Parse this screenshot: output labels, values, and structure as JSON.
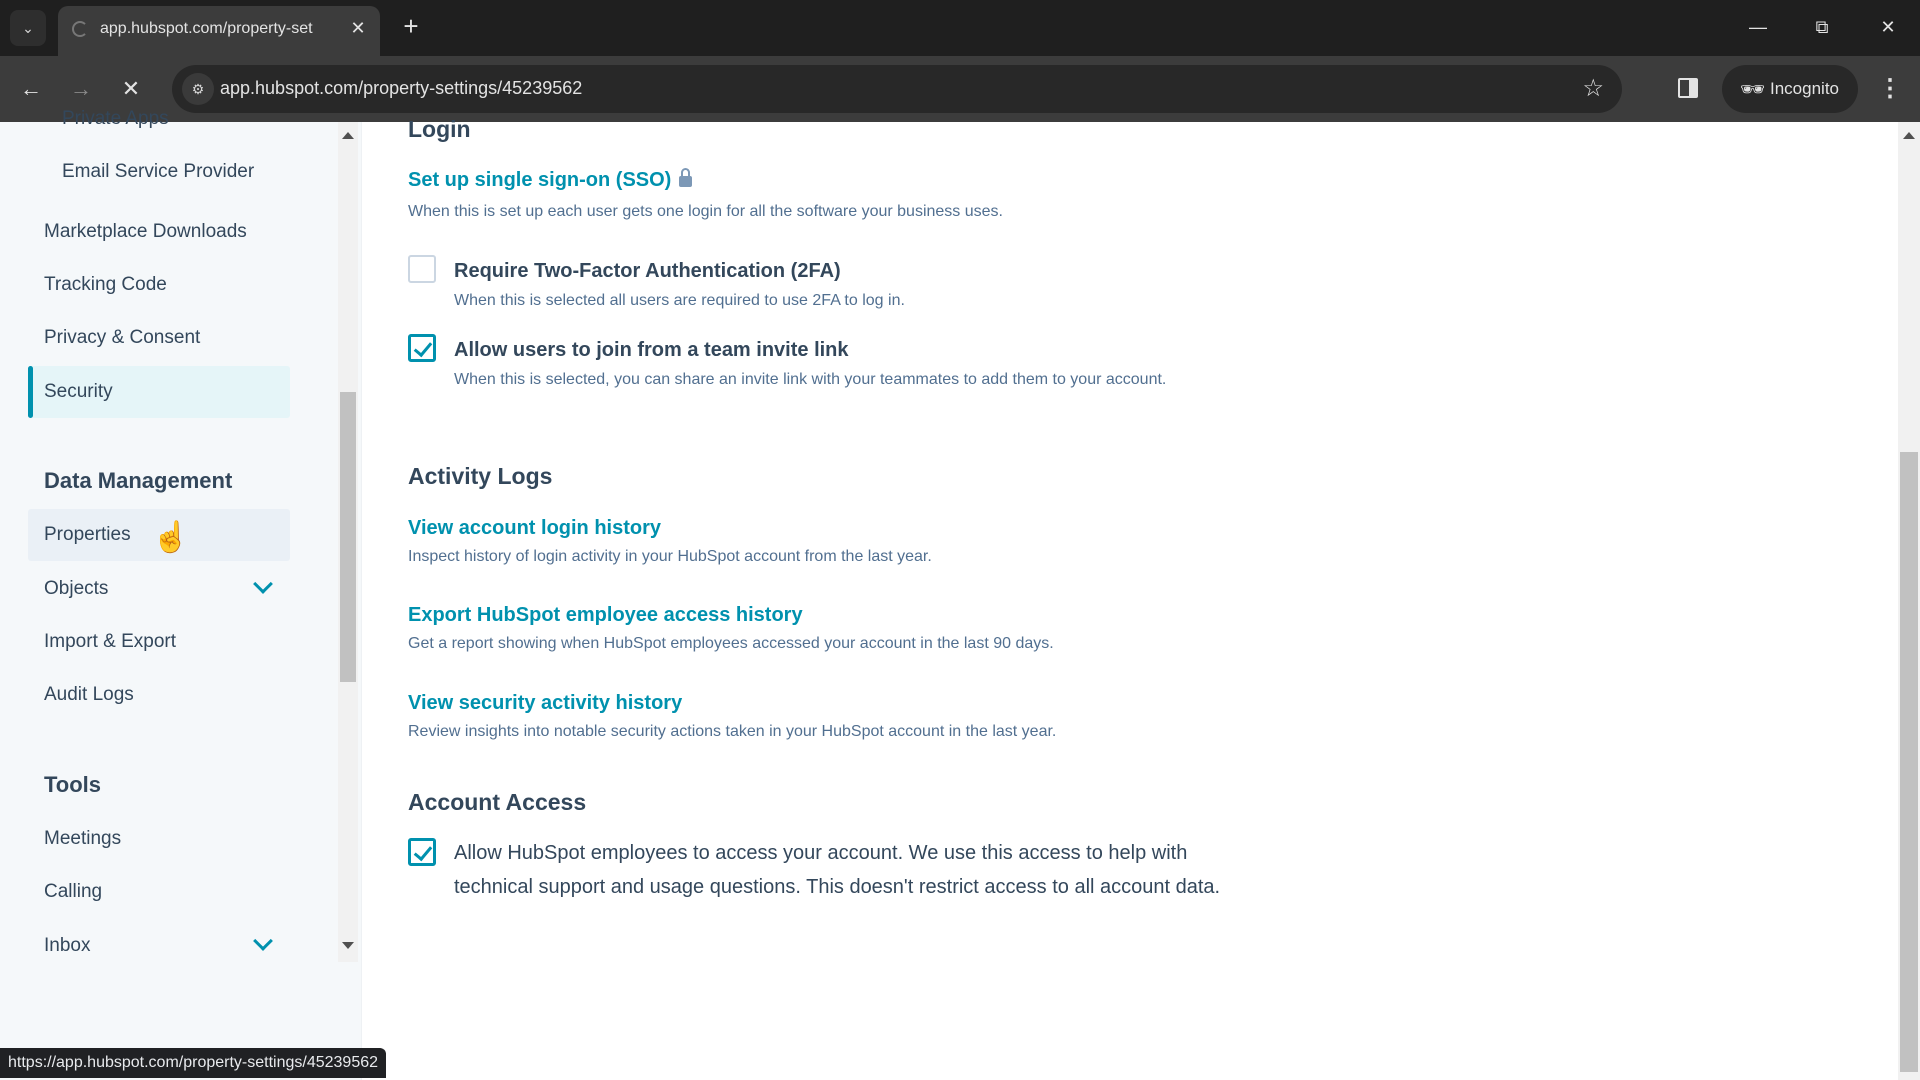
{
  "browser": {
    "tab_title": "app.hubspot.com/property-set",
    "url": "app.hubspot.com/property-settings/45239562",
    "incognito_label": "Incognito",
    "status_url": "https://app.hubspot.com/property-settings/45239562"
  },
  "sidebar": {
    "cutoff_item": "Private Apps",
    "items": [
      {
        "label": "Email Service Provider",
        "sub": true
      },
      {
        "label": "Marketplace Downloads"
      },
      {
        "label": "Tracking Code"
      },
      {
        "label": "Privacy & Consent"
      },
      {
        "label": "Security",
        "active": true
      }
    ],
    "data_management": {
      "heading": "Data Management",
      "items": [
        {
          "label": "Properties",
          "hover": true
        },
        {
          "label": "Objects",
          "expandable": true
        },
        {
          "label": "Import & Export"
        },
        {
          "label": "Audit Logs"
        }
      ]
    },
    "tools": {
      "heading": "Tools",
      "items": [
        {
          "label": "Meetings"
        },
        {
          "label": "Calling"
        },
        {
          "label": "Inbox",
          "expandable": true
        }
      ]
    }
  },
  "main": {
    "login": {
      "title": "Login",
      "sso_link": "Set up single sign-on (SSO)",
      "sso_desc": "When this is set up each user gets one login for all the software your business uses.",
      "twofa": {
        "label": "Require Two-Factor Authentication (2FA)",
        "desc": "When this is selected all users are required to use 2FA to log in.",
        "checked": false
      },
      "invite": {
        "label": "Allow users to join from a team invite link",
        "desc": "When this is selected, you can share an invite link with your teammates to add them to your account.",
        "checked": true
      }
    },
    "activity_logs": {
      "title": "Activity Logs",
      "links": [
        {
          "label": "View account login history",
          "desc": "Inspect history of login activity in your HubSpot account from the last year."
        },
        {
          "label": "Export HubSpot employee access history",
          "desc": "Get a report showing when HubSpot employees accessed your account in the last 90 days."
        },
        {
          "label": "View security activity history",
          "desc": "Review insights into notable security actions taken in your HubSpot account in the last year."
        }
      ]
    },
    "account_access": {
      "title": "Account Access",
      "label": "Allow HubSpot employees to access your account. We use this access to help with technical support and usage questions. This doesn't restrict access to all account data.",
      "checked": true
    }
  },
  "colors": {
    "accent": "#0091ae",
    "text": "#33475b",
    "muted": "#516f90",
    "sidebar_bg": "#f5f8fa"
  }
}
